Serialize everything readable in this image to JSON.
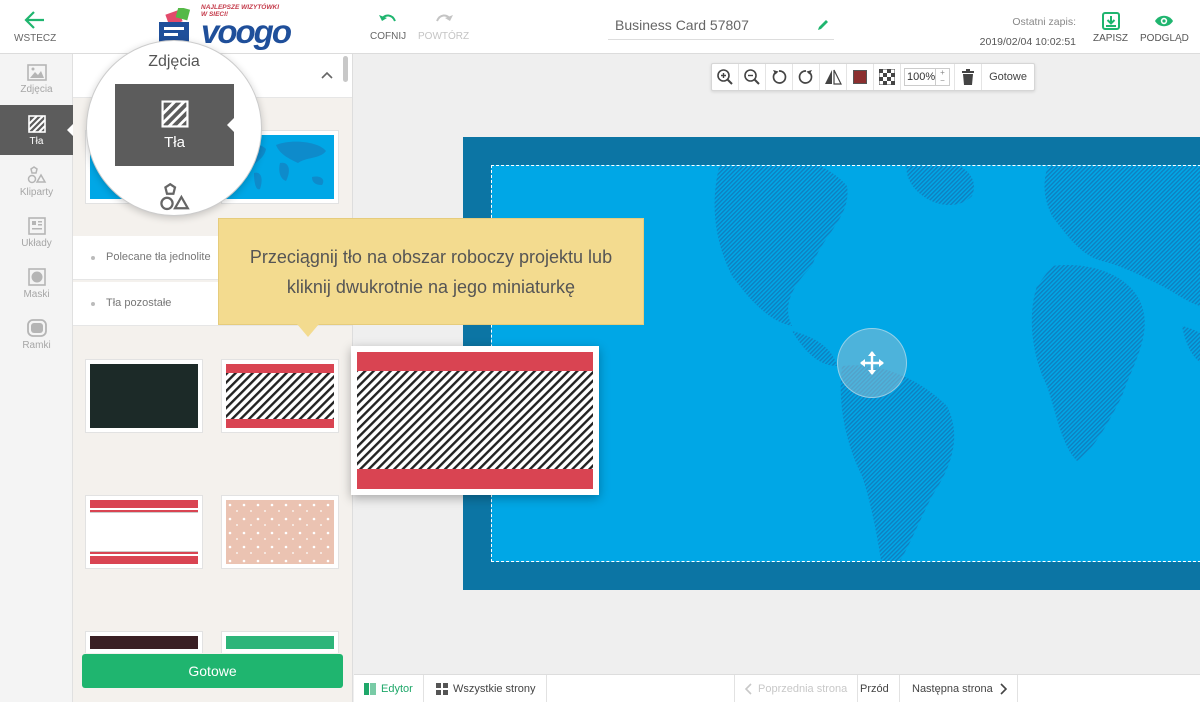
{
  "topbar": {
    "back_label": "WSTECZ",
    "logo_tagline": "NAJLEPSZE WIZYTÓWKI W SIECI!",
    "logo_word": "voogo",
    "undo_label": "COFNIJ",
    "redo_label": "POWTÓRZ",
    "project_title": "Business Card 57807",
    "last_save_label": "Ostatni zapis:",
    "last_save_time": "2019/02/04 10:02:51",
    "save_label": "ZAPISZ",
    "preview_label": "PODGLĄD"
  },
  "rail": {
    "items": [
      {
        "label": "Zdjęcia",
        "icon": "image-icon"
      },
      {
        "label": "Tła",
        "icon": "background-hatch-icon",
        "active": true
      },
      {
        "label": "Kliparty",
        "icon": "shapes-icon"
      },
      {
        "label": "Układy",
        "icon": "layout-icon"
      },
      {
        "label": "Maski",
        "icon": "mask-icon"
      },
      {
        "label": "Ramki",
        "icon": "frame-icon"
      }
    ]
  },
  "magnifier": {
    "top_label": "Zdjęcia",
    "active_label": "Tła"
  },
  "panel": {
    "categories": [
      {
        "label": "Polecane tła jednolite"
      },
      {
        "label": "Tła pozostałe"
      }
    ],
    "done_label": "Gotowe"
  },
  "tooltip": {
    "text": "Przeciągnij tło na obszar roboczy projektu lub kliknij dwukrotnie na jego miniaturkę"
  },
  "toolbar": {
    "zoom_value": "100%",
    "done_label": "Gotowe",
    "color_swatch": "#8b2f2f"
  },
  "bottombar": {
    "editor_label": "Edytor",
    "all_pages_label": "Wszystkie strony",
    "prev_page_label": "Poprzednia strona",
    "front_label": "Przód",
    "next_page_label": "Następna strona"
  },
  "colors": {
    "accent": "#1fb56f",
    "card_border": "#0c75a4",
    "card_fill": "#00a7e6",
    "stripe_red": "#d94452",
    "tooltip_bg": "#f3db8f"
  }
}
